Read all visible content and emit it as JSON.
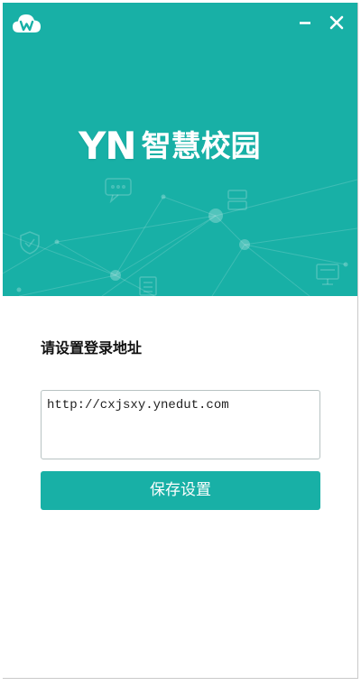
{
  "window": {
    "logo_mark": "YN",
    "logo_name": "智慧校园"
  },
  "form": {
    "title": "请设置登录地址",
    "url_value": "http://cxjsxy.ynedut.com",
    "save_label": "保存设置"
  },
  "icons": {
    "app": "cloud-w-icon",
    "minimize": "minimize-icon",
    "close": "close-icon",
    "decor": [
      "chat-bubble-icon",
      "shield-icon",
      "server-icon",
      "document-icon",
      "monitor-icon"
    ]
  },
  "colors": {
    "brand_teal": "#18b0a6",
    "text_dark": "#111111",
    "input_border": "#b8c3c3"
  }
}
